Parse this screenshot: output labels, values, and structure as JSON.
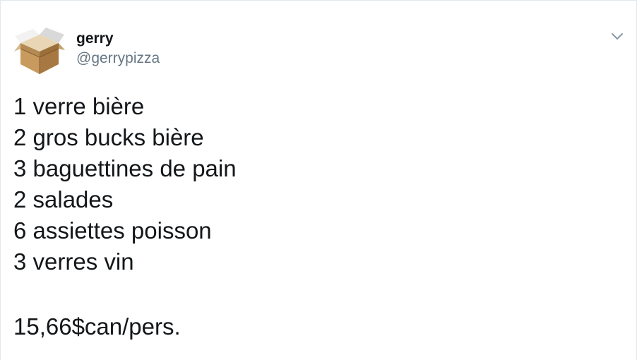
{
  "author": {
    "avatar_icon": "cardboard-box-icon",
    "display_name": "gerry",
    "handle": "@gerrypizza"
  },
  "menu": {
    "caret_icon": "chevron-down-icon"
  },
  "tweet": {
    "lines": [
      "1 verre bière",
      "2 gros bucks bière",
      "3 baguettines de pain",
      "2 salades",
      "6 assiettes poisson",
      "3 verres vin"
    ],
    "total": "15,66$can/pers."
  },
  "colors": {
    "name": "#14171a",
    "handle": "#657786",
    "caret": "#8899a6",
    "border": "#e1e8ed"
  }
}
